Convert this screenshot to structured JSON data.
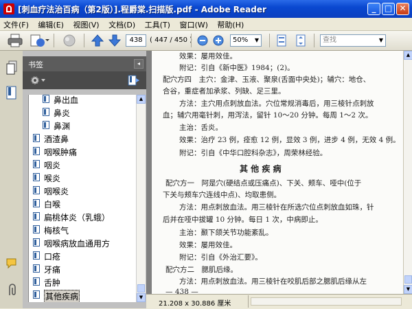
{
  "window": {
    "title": "[刺血疗法治百病（第2版）].程爵棠.扫描版.pdf - Adobe Reader",
    "min_label": "_",
    "max_label": "□",
    "close_label": "✕"
  },
  "menu": [
    "文件(F)",
    "编辑(E)",
    "视图(V)",
    "文档(D)",
    "工具(T)",
    "窗口(W)",
    "帮助(H)"
  ],
  "toolbar": {
    "page_number": "438",
    "page_count": "( 447 / 450 )",
    "zoom": "50%",
    "search_placeholder": "查找"
  },
  "bookmarks_panel": {
    "title": "书签",
    "items": [
      {
        "label": "鼻出血",
        "indent": 1
      },
      {
        "label": "鼻炎",
        "indent": 1
      },
      {
        "label": "鼻渊",
        "indent": 1
      },
      {
        "label": "酒渣鼻",
        "indent": 0
      },
      {
        "label": "咽喉肿痛",
        "indent": 0
      },
      {
        "label": "咽炎",
        "indent": 0
      },
      {
        "label": "喉炎",
        "indent": 0
      },
      {
        "label": "咽喉炎",
        "indent": 0
      },
      {
        "label": "白喉",
        "indent": 0
      },
      {
        "label": "扁桃体炎（乳蛾）",
        "indent": 0
      },
      {
        "label": "梅核气",
        "indent": 0
      },
      {
        "label": "咽喉病放血通用方",
        "indent": 0
      },
      {
        "label": "口疮",
        "indent": 0
      },
      {
        "label": "牙痛",
        "indent": 0
      },
      {
        "label": "舌肿",
        "indent": 0
      },
      {
        "label": "其他疾病",
        "indent": 0,
        "selected": true
      }
    ]
  },
  "document": {
    "lines": [
      "效果：屡用效佳。",
      "附记：引自《新中医》1984；(2)。",
      "配穴方四　主穴：金津、玉液、聚泉(舌面中央处)；辅穴：地仓、",
      "合谷，重症者加承浆、列缺、足三里。",
      "方法：主穴用点刺放血法。穴位常规消毒后，用三棱针点刺放",
      "血；辅穴用毫针刺，用泻法，留针 10～20 分钟。每周 1～2 次。",
      "主治：舌炎。",
      "效果：治疗 23 例，痊愈 12 例，显效 3 例，进步 4 例，无效 4 例。",
      "附记：引自《中华口腔科杂志》，周荣林经验。",
      "其 他 疾 病",
      "配穴方一　阿是穴(硬结点或压痛点)、下关、颊车、哑中(位于",
      "下关与颊车穴连线中点)、均取患侧。",
      "方法：用点刺放血法。用三棱针在所选穴位点刺放血如珠，针",
      "后并在哑中拔罐 10 分钟。每日 1 次，中病即止。",
      "主治：颞下颌关节功能紊乱。",
      "效果：屡用效佳。",
      "附记：引自《外治汇要》。",
      "配穴方二　腮肌后缘。",
      "方法：用点刺放血法。用三棱针在咬肌后部之腮肌后缘从左",
      "— 438 —"
    ]
  },
  "status": {
    "page_size": "21.208 x 30.886 厘米"
  }
}
